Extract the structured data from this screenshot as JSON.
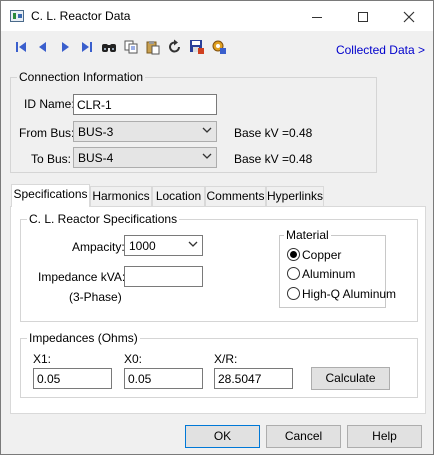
{
  "window": {
    "title": "C. L. Reactor Data"
  },
  "toolbar": {
    "collected_data_link": "Collected Data >"
  },
  "connection": {
    "group_title": "Connection Information",
    "id_label": "ID Name:",
    "id_value": "CLR-1",
    "from_bus_label": "From Bus:",
    "from_bus_value": "BUS-3",
    "from_base_kv_label": "Base kV =",
    "from_base_kv_value": "0.48",
    "to_bus_label": "To Bus:",
    "to_bus_value": "BUS-4",
    "to_base_kv_label": "Base kV =",
    "to_base_kv_value": "0.48"
  },
  "tabs": [
    "Specifications",
    "Harmonics",
    "Location",
    "Comments",
    "Hyperlinks"
  ],
  "specs": {
    "group_title": "C. L. Reactor Specifications",
    "ampacity_label": "Ampacity:",
    "ampacity_value": "1000",
    "impedance_kva_label": "Impedance kVA:",
    "impedance_kva_value": "",
    "three_phase_label": "(3-Phase)"
  },
  "material": {
    "group_title": "Material",
    "options": [
      "Copper",
      "Aluminum",
      "High-Q Aluminum"
    ],
    "selected": "Copper"
  },
  "impedances": {
    "group_title": "Impedances (Ohms)",
    "x1_label": "X1:",
    "x1_value": "0.05",
    "x0_label": "X0:",
    "x0_value": "0.05",
    "xr_label": "X/R:",
    "xr_value": "28.5047",
    "calculate_label": "Calculate"
  },
  "footer": {
    "ok_label": "OK",
    "cancel_label": "Cancel",
    "help_label": "Help"
  },
  "icons": [
    "first-record-icon",
    "previous-record-icon",
    "next-record-icon",
    "last-record-icon",
    "find-icon",
    "copy-icon",
    "paste-icon",
    "refresh-icon",
    "save-icon",
    "settings-icon"
  ],
  "colors": {
    "link": "#0000cc",
    "nav_arrow": "#3a5fcd",
    "focus_border": "#0078d7"
  }
}
